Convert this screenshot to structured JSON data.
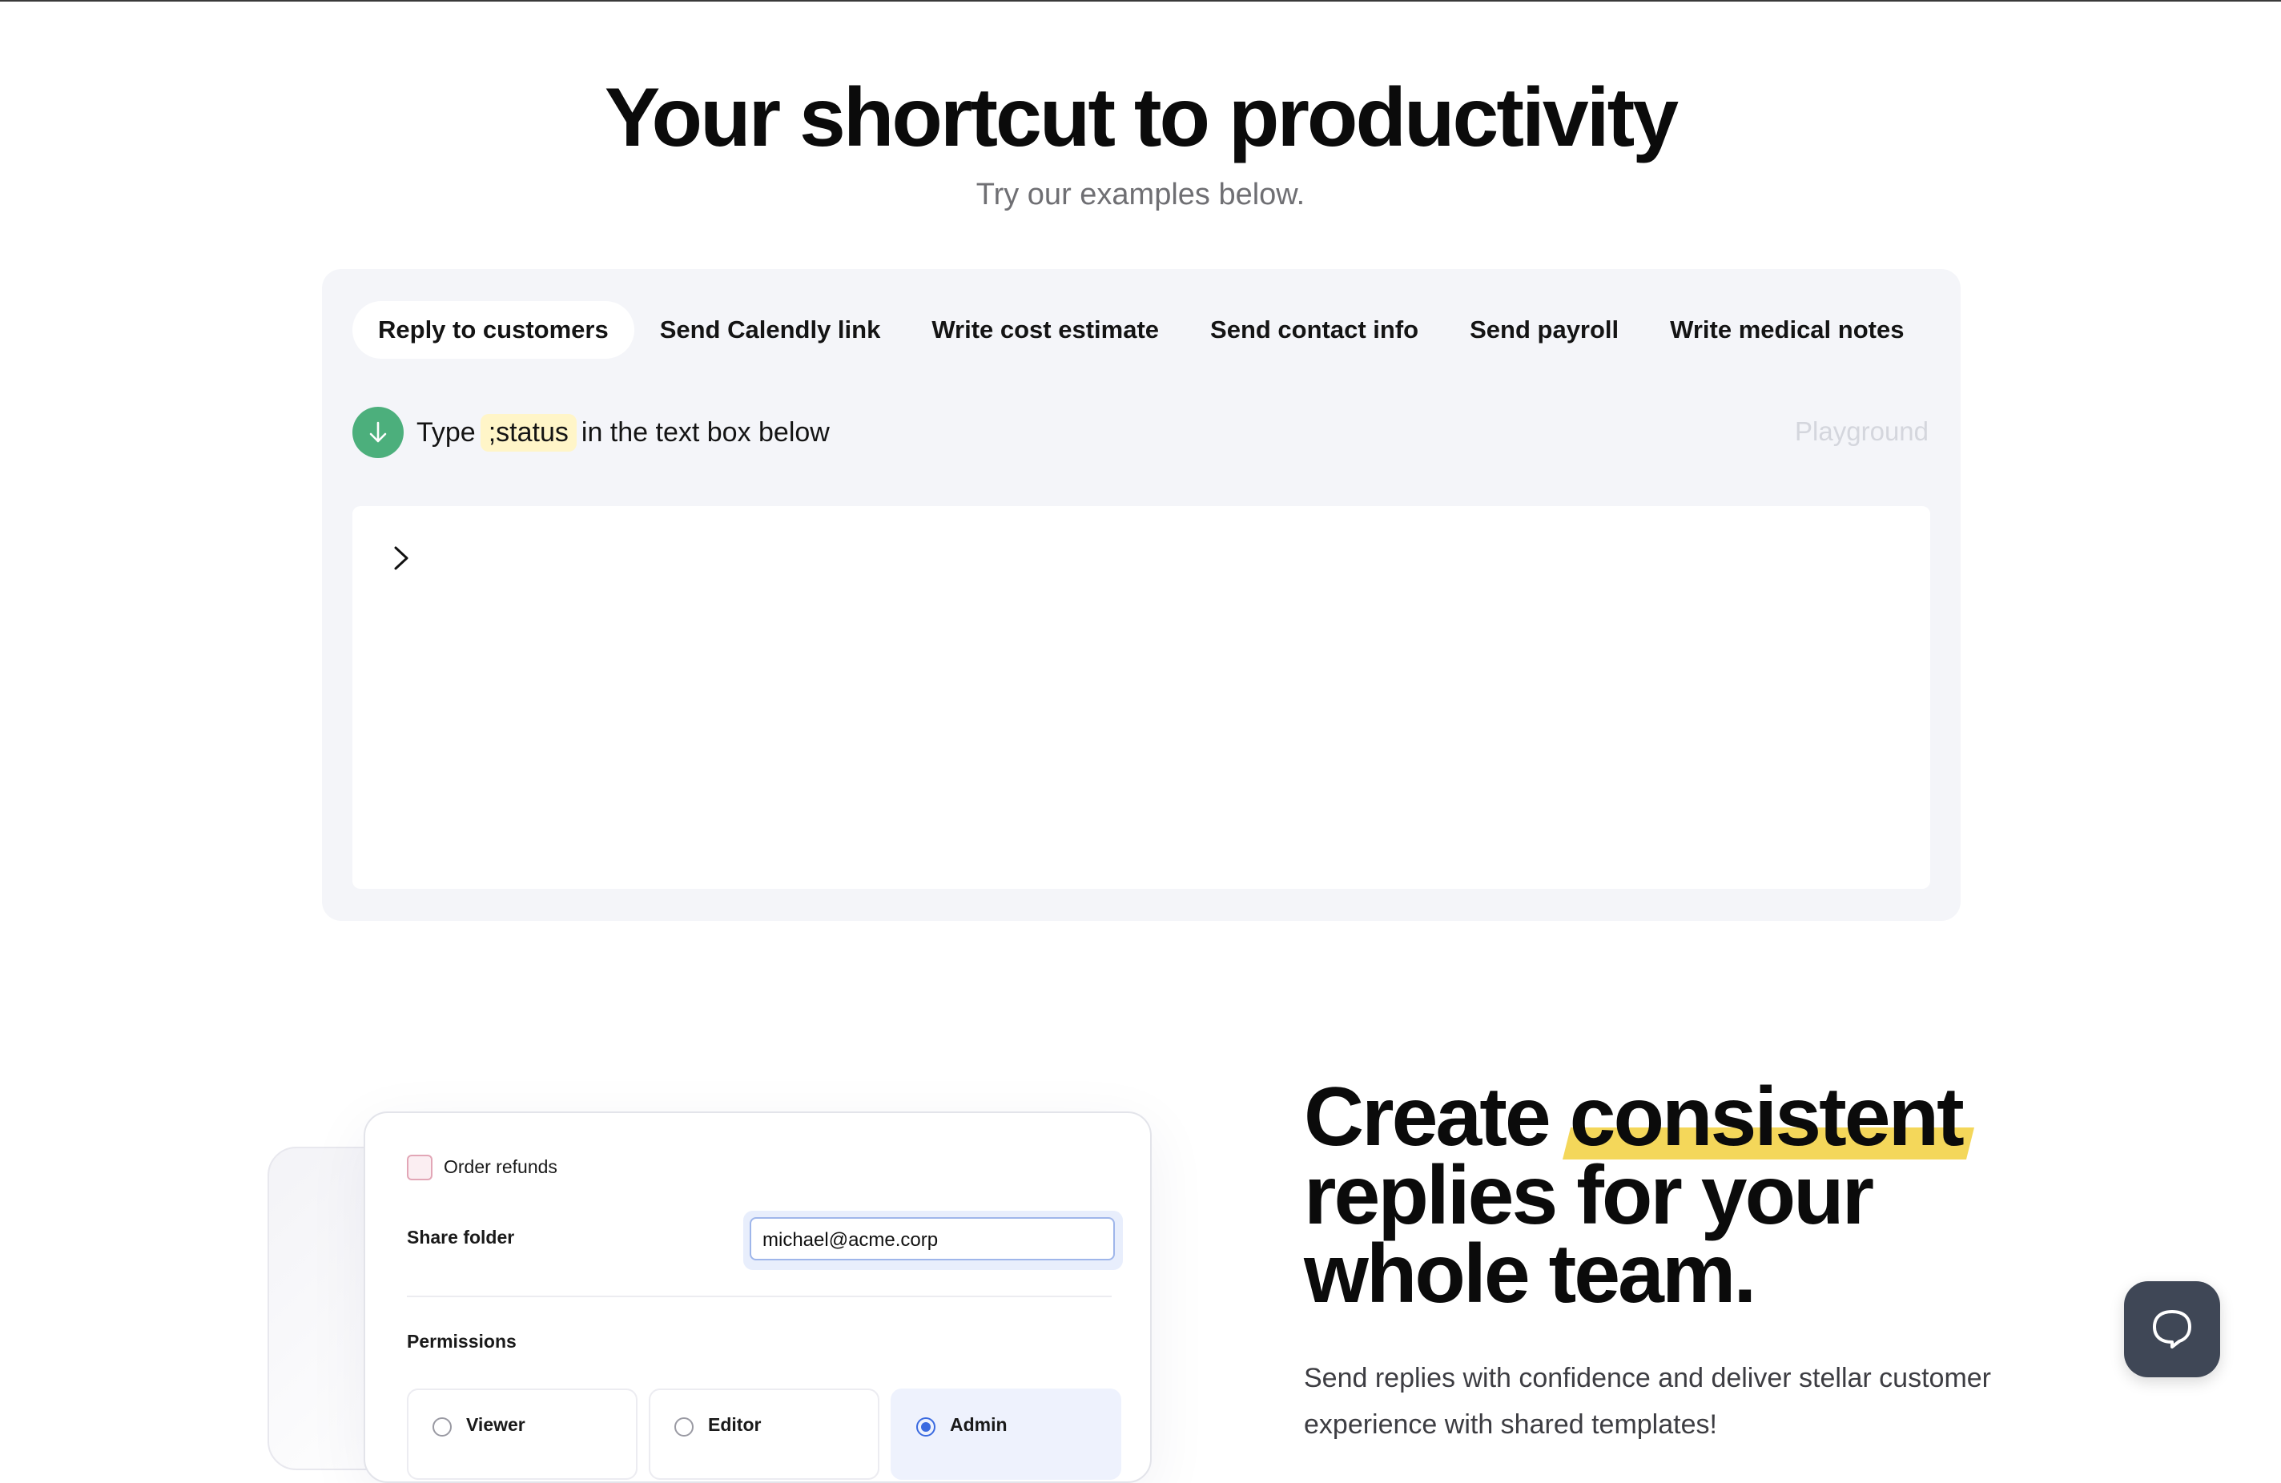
{
  "hero": {
    "title": "Your shortcut to productivity",
    "subtitle": "Try our examples below."
  },
  "tabs": [
    {
      "label": "Reply to customers",
      "active": true
    },
    {
      "label": "Send Calendly link",
      "active": false
    },
    {
      "label": "Write cost estimate",
      "active": false
    },
    {
      "label": "Send contact info",
      "active": false
    },
    {
      "label": "Send payroll",
      "active": false
    },
    {
      "label": "Write medical notes",
      "active": false
    }
  ],
  "hint": {
    "prefix": "Type",
    "code": ";status",
    "suffix": "in the text box below",
    "icon": "arrow-down-icon"
  },
  "playground_label": "Playground",
  "editor": {
    "value": ""
  },
  "form_card": {
    "checkbox_label": "Order refunds",
    "share_label": "Share folder",
    "share_value": "michael@acme.corp",
    "permissions_label": "Permissions",
    "roles": [
      {
        "label": "Viewer",
        "selected": false
      },
      {
        "label": "Editor",
        "selected": false
      },
      {
        "label": "Admin",
        "selected": true
      }
    ]
  },
  "feature": {
    "title_1a": "Create",
    "title_1b": "consistent",
    "title_2": "replies for your",
    "title_3": "whole team.",
    "description": "Send replies with confidence and deliver stellar customer experience with shared templates!"
  },
  "colors": {
    "accent_green": "#4caf7c",
    "highlight_yellow": "#f4d75a",
    "code_bg": "#fff5c8",
    "chat_button": "#3f4756"
  },
  "chat_button_icon": "chat-bubble-icon"
}
